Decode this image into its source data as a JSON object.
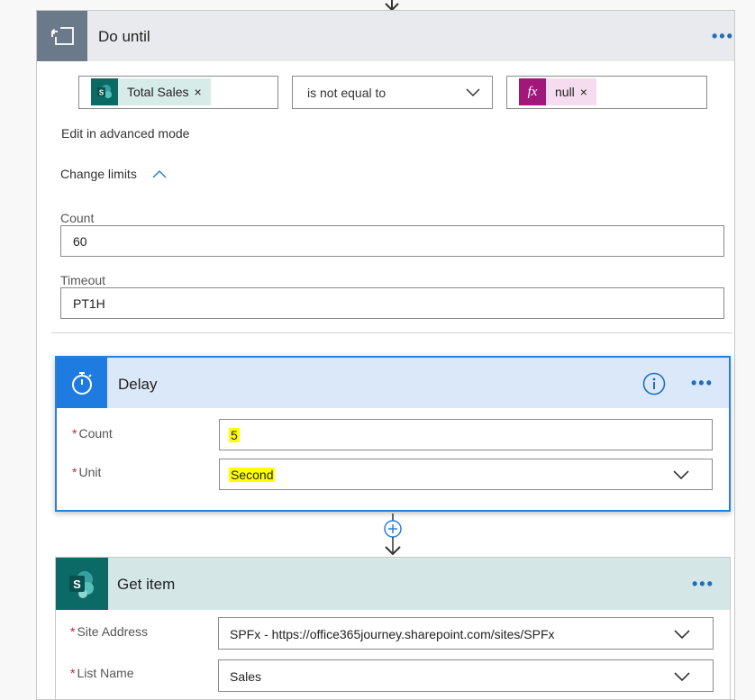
{
  "do_until": {
    "title": "Do until",
    "more_label": "•••",
    "condition": {
      "left_token": "Total Sales",
      "left_token_remove": "×",
      "operator": "is not equal to",
      "right_token_icon": "fx",
      "right_token": "null",
      "right_token_remove": "×"
    },
    "edit_advanced_label": "Edit in advanced mode",
    "change_limits_label": "Change limits",
    "count_label": "Count",
    "count_value": "60",
    "timeout_label": "Timeout",
    "timeout_value": "PT1H"
  },
  "delay": {
    "title": "Delay",
    "more_label": "•••",
    "required_marker": "*",
    "count_label": "Count",
    "count_value": "5",
    "unit_label": "Unit",
    "unit_value": "Second"
  },
  "get_item": {
    "title": "Get item",
    "more_label": "•••",
    "required_marker": "*",
    "site_label": "Site Address",
    "site_value": "SPFx - https://office365journey.sharepoint.com/sites/SPFx",
    "list_label": "List Name",
    "list_value": "Sales"
  },
  "colors": {
    "accent": "#2a80d8",
    "sharepoint": "#0b6a66",
    "expression": "#a0197a",
    "highlight": "#ffff00",
    "required": "#c4262e"
  },
  "icons": {
    "do_until": "loop-icon",
    "delay": "timer-icon",
    "sharepoint": "sharepoint-icon",
    "expression": "fx-icon",
    "info": "info-icon",
    "add": "plus-icon"
  }
}
